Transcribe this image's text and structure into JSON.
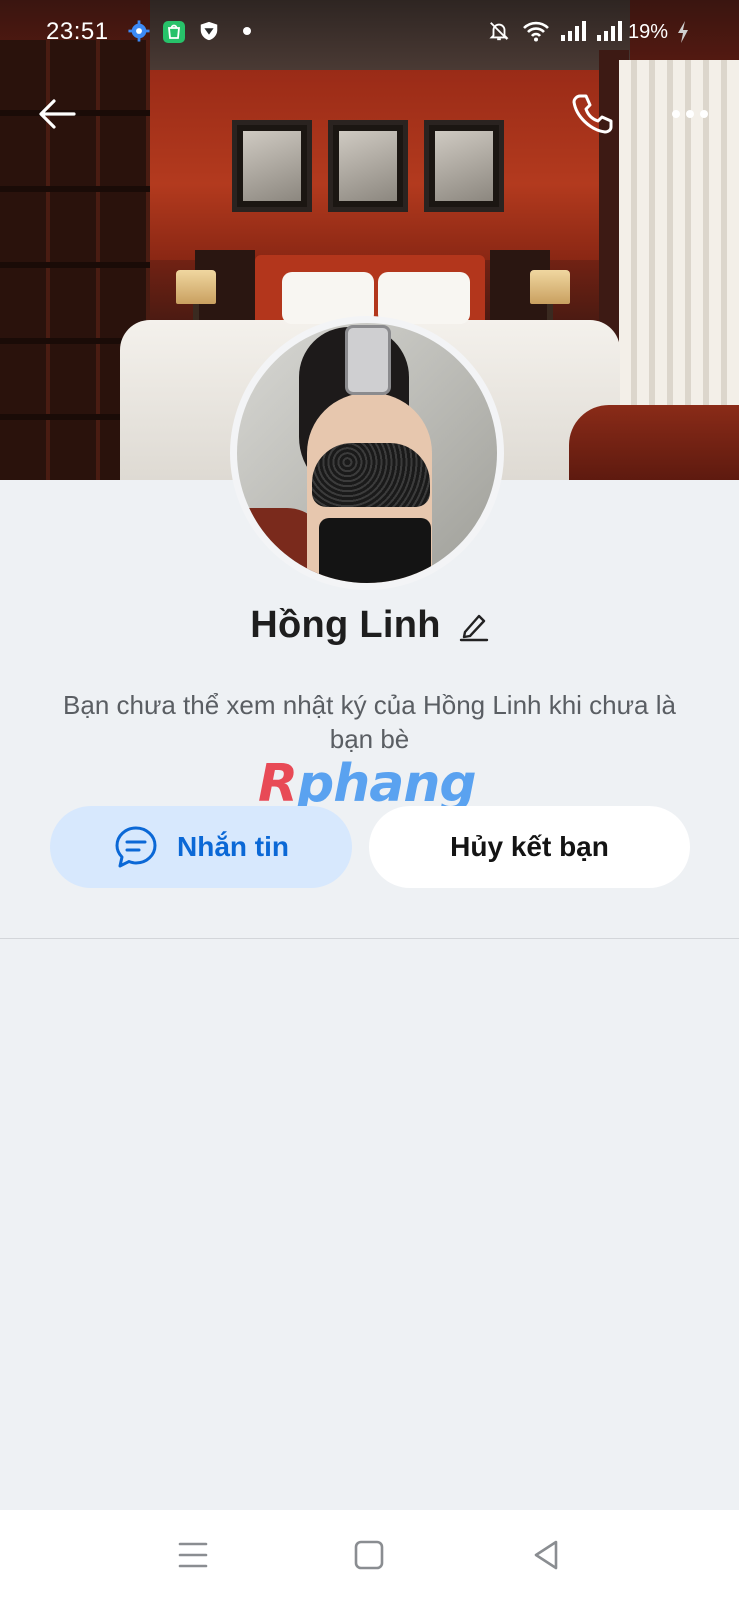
{
  "status_bar": {
    "time": "23:51",
    "battery": "19%",
    "icons": [
      "gear-icon",
      "shop-icon",
      "shield-icon",
      "dot-icon",
      "mute-bell-icon",
      "wifi-icon",
      "signal-icon",
      "signal-icon",
      "charging-icon"
    ]
  },
  "header": {
    "back_icon": "arrow-left-icon",
    "call_icon": "phone-icon",
    "more_icon": "more-icon"
  },
  "profile": {
    "name": "Hồng Linh",
    "edit_icon": "pencil-icon",
    "notice": "Bạn chưa thể xem nhật ký của Hồng Linh khi chưa là bạn bè"
  },
  "watermark": {
    "first": "R",
    "rest": "phang"
  },
  "actions": {
    "message_label": "Nhắn tin",
    "unfriend_label": "Hủy kết bạn"
  },
  "navbar": {
    "icons": [
      "menu-icon",
      "home-square-icon",
      "back-triangle-icon"
    ]
  },
  "colors": {
    "background": "#eef1f4",
    "accent_blue": "#0b68d6",
    "message_button_bg": "#d7e8fd",
    "notice_text": "#5a5e63"
  }
}
